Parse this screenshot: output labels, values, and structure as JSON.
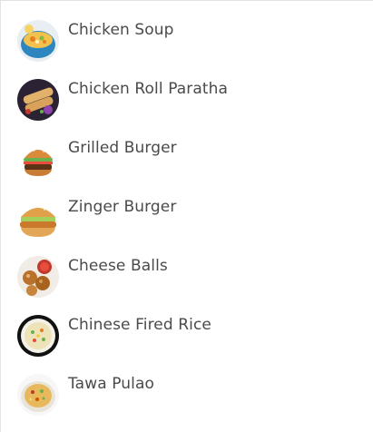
{
  "menu": {
    "items": [
      {
        "label": "Chicken Soup",
        "icon": "soup-bowl-icon"
      },
      {
        "label": "Chicken Roll Paratha",
        "icon": "roll-paratha-icon"
      },
      {
        "label": "Grilled Burger",
        "icon": "burger-icon"
      },
      {
        "label": "Zinger Burger",
        "icon": "burger-icon"
      },
      {
        "label": "Cheese Balls",
        "icon": "cheese-balls-icon"
      },
      {
        "label": "Chinese Fired Rice",
        "icon": "fried-rice-icon"
      },
      {
        "label": "Tawa Pulao",
        "icon": "pulao-icon"
      }
    ]
  }
}
